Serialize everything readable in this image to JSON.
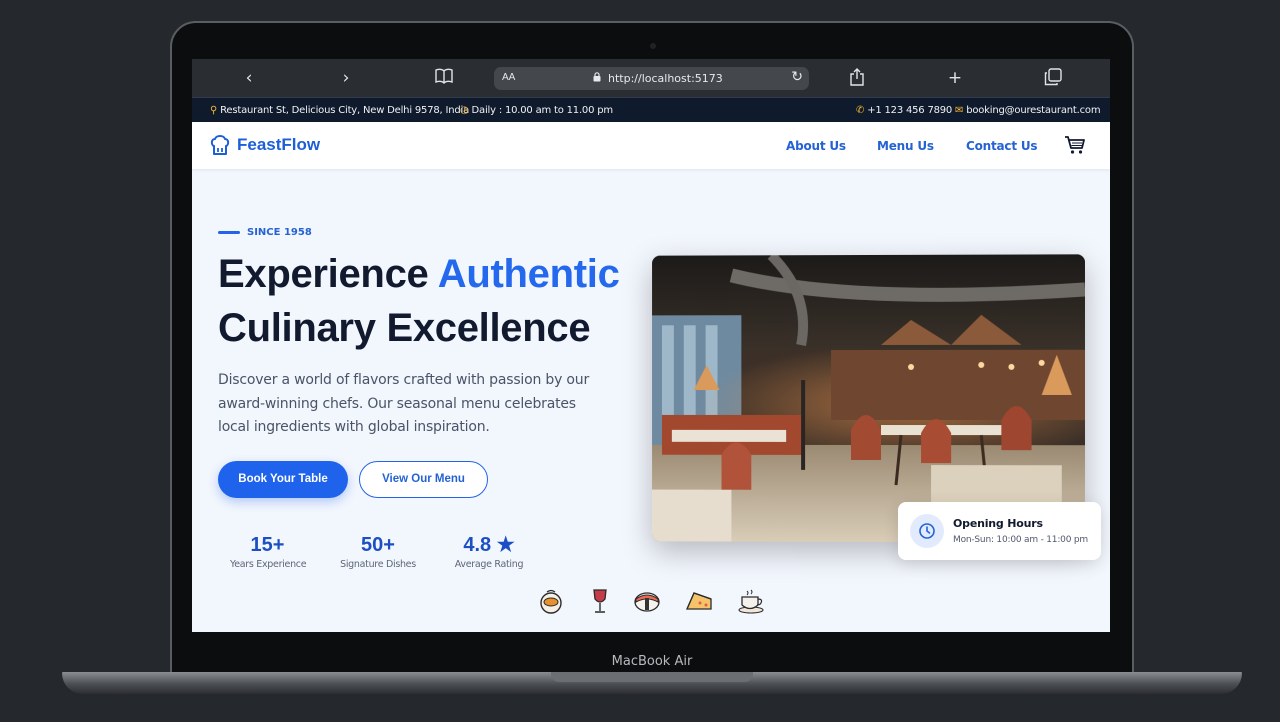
{
  "device": {
    "label": "MacBook Air"
  },
  "browser": {
    "address_aa": "AA",
    "url": "http://localhost:5173"
  },
  "infobar": {
    "address": "Restaurant St, Delicious City, New Delhi 9578, India",
    "hours": "Daily : 10.00 am to 11.00 pm",
    "phone": "+1 123 456 7890",
    "email": "booking@ourestaurant.com"
  },
  "nav": {
    "brand": "FeastFlow",
    "links": [
      "About Us",
      "Menu Us",
      "Contact Us"
    ]
  },
  "hero": {
    "eyebrow": "SINCE 1958",
    "title_part1": "Experience ",
    "title_accent": "Authentic",
    "title_line2": "Culinary Excellence",
    "description": "Discover a world of flavors crafted with passion by our award-winning chefs. Our seasonal menu celebrates local ingredients with global inspiration.",
    "primary_button": "Book Your Table",
    "secondary_button": "View Our Menu",
    "stats": [
      {
        "value": "15+",
        "label": "Years Experience"
      },
      {
        "value": "50+",
        "label": "Signature Dishes"
      },
      {
        "value": "4.8 ★",
        "label": "Average Rating"
      }
    ]
  },
  "hours_card": {
    "title": "Opening Hours",
    "text": "Mon-Sun: 10:00 am - 11:00 pm"
  },
  "food_icons": [
    "pastry-icon",
    "wine-glass-icon",
    "sushi-icon",
    "cake-slice-icon",
    "coffee-cup-icon"
  ],
  "colors": {
    "accent": "#2468ee",
    "dark": "#111a2e",
    "infobar_bg": "#0f1a2c",
    "highlight": "#f5b731"
  }
}
